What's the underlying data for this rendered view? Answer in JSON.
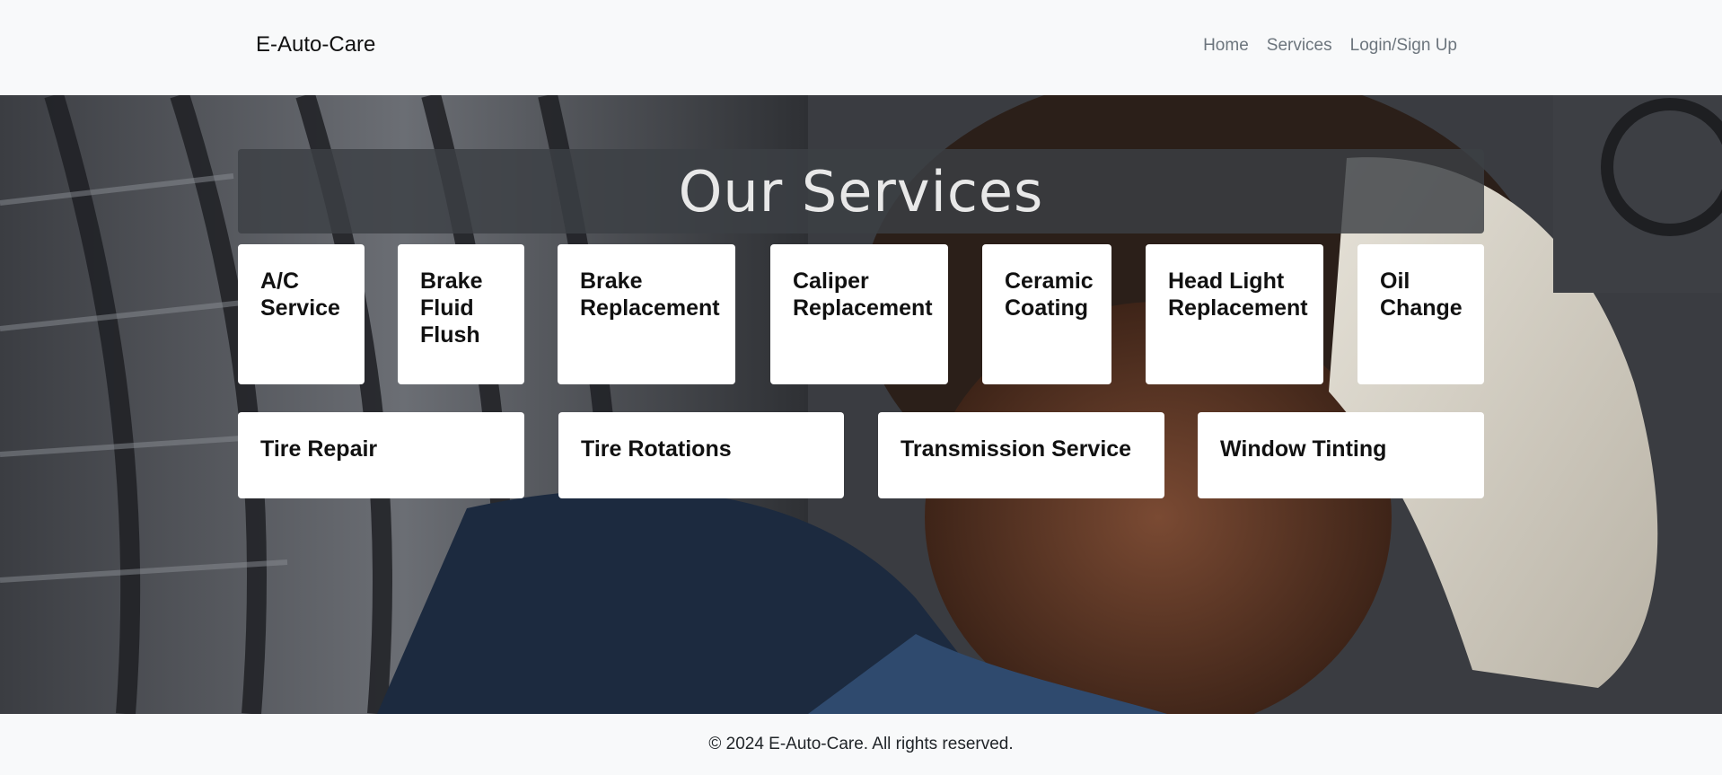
{
  "navbar": {
    "brand": "E-Auto-Care",
    "links": [
      "Home",
      "Services",
      "Login/Sign Up"
    ]
  },
  "hero": {
    "title": "Our Services"
  },
  "services": {
    "row1": [
      "A/C Service",
      "Brake Fluid Flush",
      "Brake Replacement",
      "Caliper Replacement",
      "Ceramic Coating",
      "Head Light Replacement",
      "Oil Change"
    ],
    "row2": [
      "Tire Repair",
      "Tire Rotations",
      "Transmission Service",
      "Window Tinting"
    ]
  },
  "footer": {
    "text": "© 2024 E-Auto-Care. All rights reserved."
  },
  "colors": {
    "card_bg": "#ffffff",
    "nav_bg": "#f8f9fa",
    "title_bar": "#3c3f44",
    "link": "#6c757d"
  }
}
